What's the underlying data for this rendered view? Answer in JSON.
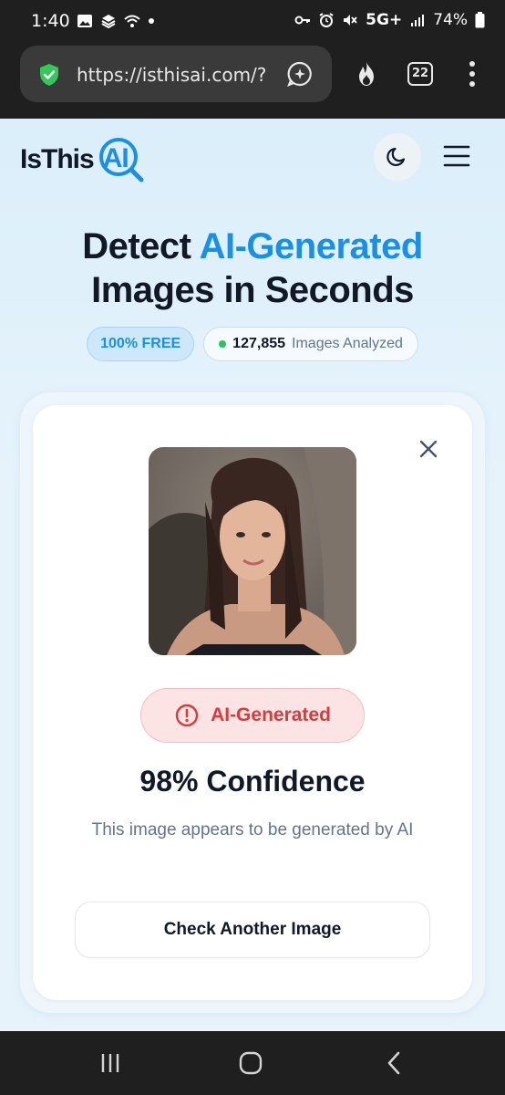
{
  "status": {
    "time": "1:40",
    "network": "5G+",
    "battery": "74%"
  },
  "browser": {
    "url": "https://isthisai.com/?",
    "tab_count": "22"
  },
  "header": {
    "logo_prefix": "IsThis",
    "logo_ai": "AI"
  },
  "hero": {
    "title_part1": "Detect ",
    "title_accent": "AI-Generated",
    "title_line2": "Images in Seconds"
  },
  "badges": {
    "free": "100% FREE",
    "count": "127,855",
    "count_suffix": "Images Analyzed"
  },
  "result": {
    "label": "AI-Generated",
    "confidence": "98% Confidence",
    "explanation": "This image appears to be generated by AI",
    "check_another": "Check Another Image"
  },
  "colors": {
    "accent": "#1a8fe6",
    "danger": "#dc3a3a",
    "success": "#22c55e"
  },
  "icons": [
    "shield-check-icon",
    "assistant-icon",
    "fire-icon",
    "tabs-icon",
    "kebab-menu-icon",
    "moon-icon",
    "hamburger-menu-icon",
    "close-icon",
    "alert-circle-icon",
    "recents-icon",
    "home-icon",
    "back-icon"
  ]
}
